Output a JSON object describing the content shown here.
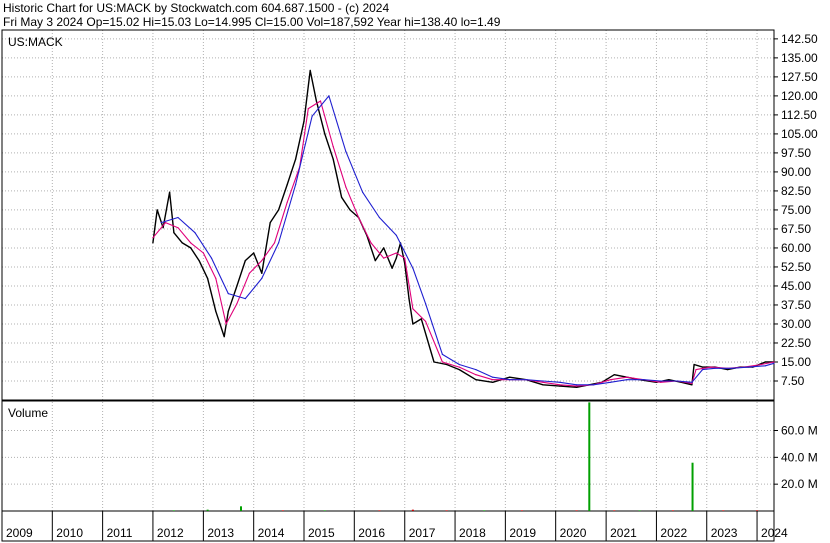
{
  "header": {
    "line1": "Historic Chart for US:MACK by Stockwatch.com 604.687.1500 - (c) 2024",
    "line2": "Fri May  3 2024   Op=15.02  Hi=15.03  Lo=14.995  Cl=15.00  Vol=187,592  Year hi=138.40  lo=1.49"
  },
  "colors": {
    "price": "#000000",
    "ma_short": "#e0007a",
    "ma_long": "#1f1fd0",
    "volume_up": "#00a000",
    "volume_down": "#d00000",
    "grid": "#b0b0b0"
  },
  "chart_data": [
    {
      "type": "line",
      "title": "US:MACK",
      "price_ticks": [
        "142.50",
        "135.00",
        "127.50",
        "120.00",
        "112.50",
        "105.00",
        "97.50",
        "90.00",
        "82.50",
        "75.00",
        "67.50",
        "60.00",
        "52.50",
        "45.00",
        "37.50",
        "30.00",
        "22.50",
        "15.00",
        "7.50"
      ],
      "ylim": [
        0,
        146
      ],
      "scale": "linear",
      "x_ticks": [
        "2009",
        "2010",
        "2011",
        "2012",
        "2013",
        "2014",
        "2015",
        "2016",
        "2017",
        "2018",
        "2019",
        "2020",
        "2021",
        "2022",
        "2023",
        "2024"
      ],
      "xlim": [
        "2009-01-01",
        "2024-05-03"
      ],
      "grid": true,
      "series": [
        {
          "key": "close",
          "x": [
            "2012-01-01",
            "2012-02-01",
            "2012-03-15",
            "2012-05-01",
            "2012-06-01",
            "2012-08-01",
            "2012-10-01",
            "2012-12-01",
            "2013-02-01",
            "2013-04-01",
            "2013-06-01",
            "2013-07-01",
            "2013-09-01",
            "2013-11-01",
            "2014-01-01",
            "2014-03-01",
            "2014-05-01",
            "2014-07-01",
            "2014-09-01",
            "2014-11-01",
            "2015-01-01",
            "2015-02-15",
            "2015-04-01",
            "2015-06-01",
            "2015-08-01",
            "2015-10-01",
            "2015-12-01",
            "2016-02-01",
            "2016-04-01",
            "2016-06-01",
            "2016-08-01",
            "2016-10-01",
            "2016-11-01",
            "2016-12-01",
            "2017-01-01",
            "2017-02-01",
            "2017-03-01",
            "2017-05-01",
            "2017-08-01",
            "2017-11-01",
            "2018-02-01",
            "2018-06-01",
            "2018-10-01",
            "2019-02-01",
            "2019-06-01",
            "2019-10-01",
            "2020-02-01",
            "2020-06-01",
            "2020-09-01",
            "2020-12-01",
            "2021-03-01",
            "2021-06-01",
            "2021-09-01",
            "2022-01-01",
            "2022-04-01",
            "2022-07-01",
            "2022-09-15",
            "2022-10-01",
            "2022-12-01",
            "2023-03-01",
            "2023-06-01",
            "2023-09-01",
            "2023-12-01",
            "2024-03-01",
            "2024-05-03"
          ],
          "values": [
            62,
            75,
            68,
            82,
            66,
            62,
            60,
            55,
            48,
            35,
            25,
            35,
            45,
            55,
            58,
            50,
            70,
            75,
            85,
            95,
            110,
            130,
            118,
            105,
            95,
            80,
            75,
            72,
            65,
            55,
            60,
            52,
            56,
            62,
            54,
            40,
            30,
            32,
            15,
            14,
            12,
            8,
            7,
            9,
            8,
            6,
            5.5,
            5,
            6,
            7,
            10,
            9,
            8,
            7,
            8,
            7,
            6,
            14,
            13,
            13,
            12,
            13,
            13,
            15,
            15
          ]
        },
        {
          "key": "ma_short",
          "x": [
            "2012-01-01",
            "2012-04-01",
            "2012-07-01",
            "2012-10-01",
            "2013-01-01",
            "2013-04-01",
            "2013-06-15",
            "2013-09-01",
            "2013-12-01",
            "2014-03-01",
            "2014-06-01",
            "2014-09-01",
            "2014-12-01",
            "2015-02-01",
            "2015-05-01",
            "2015-08-01",
            "2015-11-01",
            "2016-02-01",
            "2016-05-01",
            "2016-08-01",
            "2016-11-01",
            "2017-01-01",
            "2017-03-01",
            "2017-06-01",
            "2017-10-01",
            "2018-02-01",
            "2018-06-01",
            "2018-10-01",
            "2019-02-01",
            "2019-06-01",
            "2019-10-01",
            "2020-02-01",
            "2020-06-01",
            "2020-10-01",
            "2021-02-01",
            "2021-06-01",
            "2021-10-01",
            "2022-02-01",
            "2022-06-01",
            "2022-09-15",
            "2022-10-15",
            "2023-02-01",
            "2023-06-01",
            "2023-10-01",
            "2024-02-01",
            "2024-05-03"
          ],
          "values": [
            64,
            70,
            68,
            62,
            58,
            48,
            30,
            38,
            50,
            55,
            62,
            78,
            92,
            115,
            118,
            100,
            84,
            72,
            62,
            56,
            58,
            56,
            36,
            31,
            15,
            13,
            10,
            8,
            8,
            8,
            7,
            6,
            5.5,
            6,
            8,
            9,
            8,
            7,
            7.5,
            6.5,
            12,
            13,
            12.5,
            13,
            14,
            15
          ]
        },
        {
          "key": "ma_long",
          "x": [
            "2012-03-01",
            "2012-07-01",
            "2012-11-01",
            "2013-03-01",
            "2013-07-01",
            "2013-11-01",
            "2014-03-01",
            "2014-07-01",
            "2014-11-01",
            "2015-03-01",
            "2015-07-01",
            "2015-11-01",
            "2016-03-01",
            "2016-07-01",
            "2016-11-01",
            "2017-03-01",
            "2017-06-01",
            "2017-10-01",
            "2018-02-01",
            "2018-06-01",
            "2018-10-01",
            "2019-02-01",
            "2019-06-01",
            "2019-10-01",
            "2020-02-01",
            "2020-06-01",
            "2020-10-01",
            "2021-02-01",
            "2021-06-01",
            "2021-10-01",
            "2022-02-01",
            "2022-06-01",
            "2022-09-15",
            "2022-12-01",
            "2023-03-01",
            "2023-07-01",
            "2023-11-01",
            "2024-03-01",
            "2024-05-03"
          ],
          "values": [
            70,
            72,
            66,
            56,
            42,
            40,
            48,
            62,
            85,
            112,
            120,
            98,
            82,
            72,
            65,
            52,
            38,
            18,
            14,
            12,
            9,
            8,
            8,
            7.5,
            7,
            6,
            6,
            7,
            8,
            8,
            7.5,
            7.5,
            7,
            12,
            12.5,
            12.5,
            13,
            13.5,
            14.5
          ]
        }
      ]
    },
    {
      "type": "bar",
      "title": "Volume",
      "ticks": [
        "60.0 M",
        "40.0 M",
        "20.0 M"
      ],
      "ylim": [
        0,
        82
      ],
      "units": "M",
      "x": [
        "2012-06-01",
        "2013-02-01",
        "2013-10-01",
        "2014-08-01",
        "2015-06-01",
        "2016-07-01",
        "2017-03-01",
        "2017-11-01",
        "2018-08-01",
        "2019-05-01",
        "2020-06-01",
        "2020-09-01",
        "2021-03-01",
        "2021-09-01",
        "2022-05-01",
        "2022-09-20",
        "2023-05-01",
        "2024-01-01"
      ],
      "values": [
        0.5,
        1.0,
        3.5,
        0.5,
        0.5,
        0.5,
        1.0,
        0.5,
        0.5,
        0.5,
        0.5,
        81,
        0.5,
        0.5,
        0.5,
        36,
        0.5,
        0.5
      ],
      "direction": [
        "up",
        "up",
        "up",
        "down",
        "up",
        "down",
        "down",
        "down",
        "up",
        "down",
        "down",
        "up",
        "down",
        "up",
        "down",
        "up",
        "down",
        "down"
      ]
    }
  ]
}
